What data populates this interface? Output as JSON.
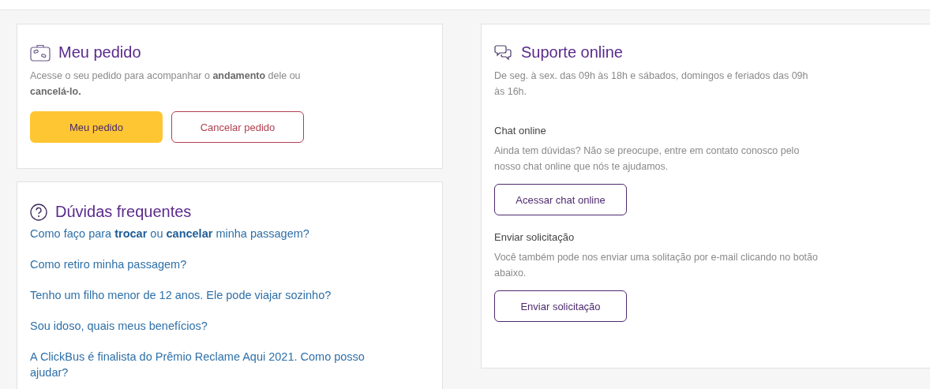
{
  "order_card": {
    "title": "Meu pedido",
    "description": "Acesse o seu pedido para acompanhar o **andamento** dele ou **cancelá-lo.**",
    "buttons": [
      {
        "label": "Meu pedido",
        "kind": "primary"
      },
      {
        "label": "Cancelar pedido",
        "kind": "danger"
      }
    ]
  },
  "faq_card": {
    "title": "Dúvidas frequentes",
    "questions": [
      "Como faço para **trocar** ou **cancelar** minha passagem?",
      "Como retiro minha passagem?",
      "Tenho um filho menor de 12 anos. Ele pode viajar sozinho?",
      "Sou idoso, quais meus benefícios?",
      "A ClickBus é finalista do Prêmio Reclame Aqui 2021. Como posso ajudar?"
    ]
  },
  "support_card": {
    "title": "Suporte online",
    "hours": "De seg. à sex. das 09h às 18h e sábados, domingos e feriados das 09h às 16h.",
    "sections": [
      {
        "heading": "Chat online",
        "text": "Ainda tem dúvidas? Não se preocupe, entre em contato conosco pelo nosso chat online que nós te ajudamos.",
        "button": {
          "label": "Acessar chat online",
          "kind": "outline"
        }
      },
      {
        "heading": "Enviar solicitação",
        "text": "Você também pode nos enviar uma solitação por e-mail clicando no botão abaixo.",
        "button": {
          "label": "Enviar solicitação",
          "kind": "outline"
        }
      }
    ]
  }
}
